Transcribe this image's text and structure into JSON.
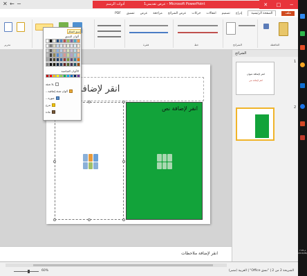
{
  "window": {
    "context_tab": "أدوات الرسم",
    "title": "عرض تقديمي1 - Microsoft PowerPoint",
    "min": "−",
    "max": "□",
    "close": "✕"
  },
  "tabs": [
    "الصفحة الرئيسية",
    "إدراج",
    "تصميم",
    "انتقالات",
    "حركات",
    "عرض الشرائح",
    "مراجعة",
    "عرض",
    "تنسيق"
  ],
  "tabs_extra": "PDF",
  "ribbon": {
    "group_clipboard": "الحافظة",
    "group_slides": "الشرائح",
    "group_font": "خط",
    "group_paragraph": "فقرة",
    "group_drawing": "رسم",
    "group_editing": "تحرير",
    "acrobat": "Adobe Acrobat",
    "pdf_label": "PDF"
  },
  "dropdown": {
    "selected": "نسق الشكل",
    "theme_colors_header": "ألوان النسق",
    "standard_colors_header": "الألوان القياسية",
    "items": [
      "بلا تعبئة",
      "ألوان تعبئة إضافية...",
      "صورة...",
      "تدرج",
      "مادة"
    ],
    "theme_colors": [
      [
        "#ffffff",
        "#000000",
        "#eeece1",
        "#1f497d",
        "#4f81bd",
        "#c0504d",
        "#9bbb59",
        "#8064a2",
        "#4bacc6",
        "#f79646"
      ],
      [
        "#f2f2f2",
        "#7f7f7f",
        "#ddd9c3",
        "#c6d9f0",
        "#dbe5f1",
        "#f2dcdb",
        "#ebf1dd",
        "#e5e0ec",
        "#dbeef3",
        "#fdeada"
      ],
      [
        "#d8d8d8",
        "#595959",
        "#c4bd97",
        "#8db3e2",
        "#b8cce4",
        "#e5b9b7",
        "#d7e3bc",
        "#ccc1d9",
        "#b7dde8",
        "#fbd5b5"
      ],
      [
        "#bfbfbf",
        "#3f3f3f",
        "#938953",
        "#548dd4",
        "#95b3d7",
        "#d99694",
        "#c3d69b",
        "#b2a2c7",
        "#92cddc",
        "#fac08f"
      ],
      [
        "#a5a5a5",
        "#262626",
        "#494429",
        "#17365d",
        "#366092",
        "#953734",
        "#76923c",
        "#5f497a",
        "#31859b",
        "#e36c09"
      ],
      [
        "#7f7f7f",
        "#0c0c0c",
        "#1d1b10",
        "#0f243e",
        "#244061",
        "#632423",
        "#4f6128",
        "#3f3151",
        "#205867",
        "#974806"
      ]
    ],
    "standard_colors": [
      "#c00000",
      "#ff0000",
      "#ffc000",
      "#ffff00",
      "#92d050",
      "#00b050",
      "#00b0f0",
      "#0070c0",
      "#002060",
      "#7030a0"
    ]
  },
  "slide": {
    "title_placeholder": "انقر لإضافة عنوان",
    "text_placeholder": "انقر لإضافة نص",
    "green_fill": "#12a33a"
  },
  "notes_placeholder": "انقر لإضافة ملاحظات",
  "slides_pane": {
    "tabs": "الشرائح",
    "thumb1_title": "انقر لإضافة عنوان",
    "thumb1_subtitle": "انقر لإضافة نص",
    "num1": "1",
    "num2": "2"
  },
  "status": {
    "slide_info": "الشريحة 2 من 2",
    "theme": "\"نسق Office\"",
    "language": "العربية (مصر)",
    "zoom": "60%",
    "zoom_value": 0.6
  },
  "system_clock": {
    "time": "7:05 م",
    "date": "2016/08/01"
  }
}
